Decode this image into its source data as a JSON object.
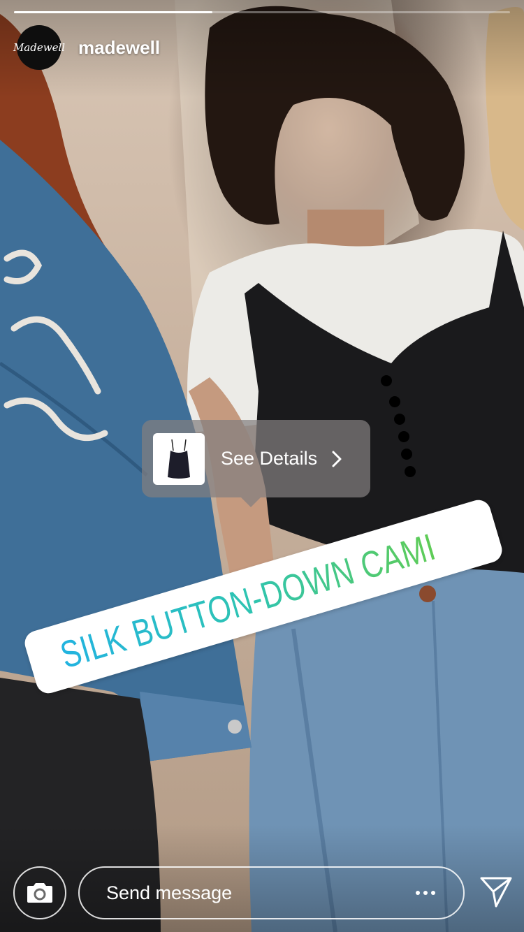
{
  "story": {
    "progress": 0.4,
    "account": {
      "avatar_text": "Madewell",
      "username": "madewell"
    }
  },
  "product_tag": {
    "label": "See Details",
    "sticker_text": "SILK BUTTON-DOWN CAMI",
    "sticker_icon": "shopping-bag-icon",
    "sticker_gradient": [
      "#22b3e0",
      "#2ec4b2",
      "#5fcc55"
    ]
  },
  "footer": {
    "camera_icon": "camera-icon",
    "message_placeholder": "Send message",
    "more_icon": "more-icon",
    "send_icon": "direct-send-icon"
  }
}
